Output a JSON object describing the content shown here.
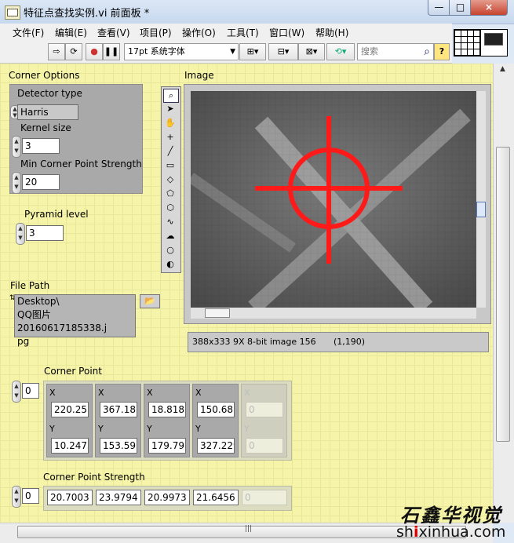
{
  "window": {
    "title": "特征点查找实例.vi 前面板 *",
    "close_glyph": "×",
    "min_glyph": "—",
    "max_glyph": "□"
  },
  "menu": [
    "文件(F)",
    "编辑(E)",
    "查看(V)",
    "项目(P)",
    "操作(O)",
    "工具(T)",
    "窗口(W)",
    "帮助(H)"
  ],
  "toolbar": {
    "font": "17pt 系统字体",
    "search_placeholder": "搜索",
    "help": "?"
  },
  "corner_options": {
    "label": "Corner Options",
    "detector_type_label": "Detector type",
    "detector_type_value": "Harris",
    "kernel_size_label": "Kernel size",
    "kernel_size_value": "3",
    "min_strength_label": "Min Corner Point Strength",
    "min_strength_value": "20"
  },
  "pyramid": {
    "label": "Pyramid level",
    "value": "3"
  },
  "file_path": {
    "label": "File Path",
    "value_lines": [
      "Desktop\\",
      "QQ图片20160617185338.j",
      "pg"
    ]
  },
  "image": {
    "label": "Image",
    "status": "388x333 9X 8-bit image 156",
    "coords": "(1,190)"
  },
  "corner_point": {
    "label": "Corner Point",
    "index": "0",
    "x_label": "X",
    "y_label": "Y",
    "x": [
      "220.251",
      "367.185",
      "18.8183",
      "150.681",
      "0"
    ],
    "y": [
      "10.2473",
      "153.597",
      "179.798",
      "327.229",
      "0"
    ]
  },
  "corner_strength": {
    "label": "Corner Point Strength",
    "index": "0",
    "values": [
      "20.7003",
      "23.9794",
      "20.9973",
      "21.6456",
      "0"
    ]
  },
  "watermark": {
    "cn": "石鑫华视觉",
    "url_prefix": "sh",
    "url_accent": "i",
    "url_rest": "xinhua.com"
  },
  "colors": {
    "panel": "#f6f4a8",
    "marker": "#ff1a1a"
  }
}
